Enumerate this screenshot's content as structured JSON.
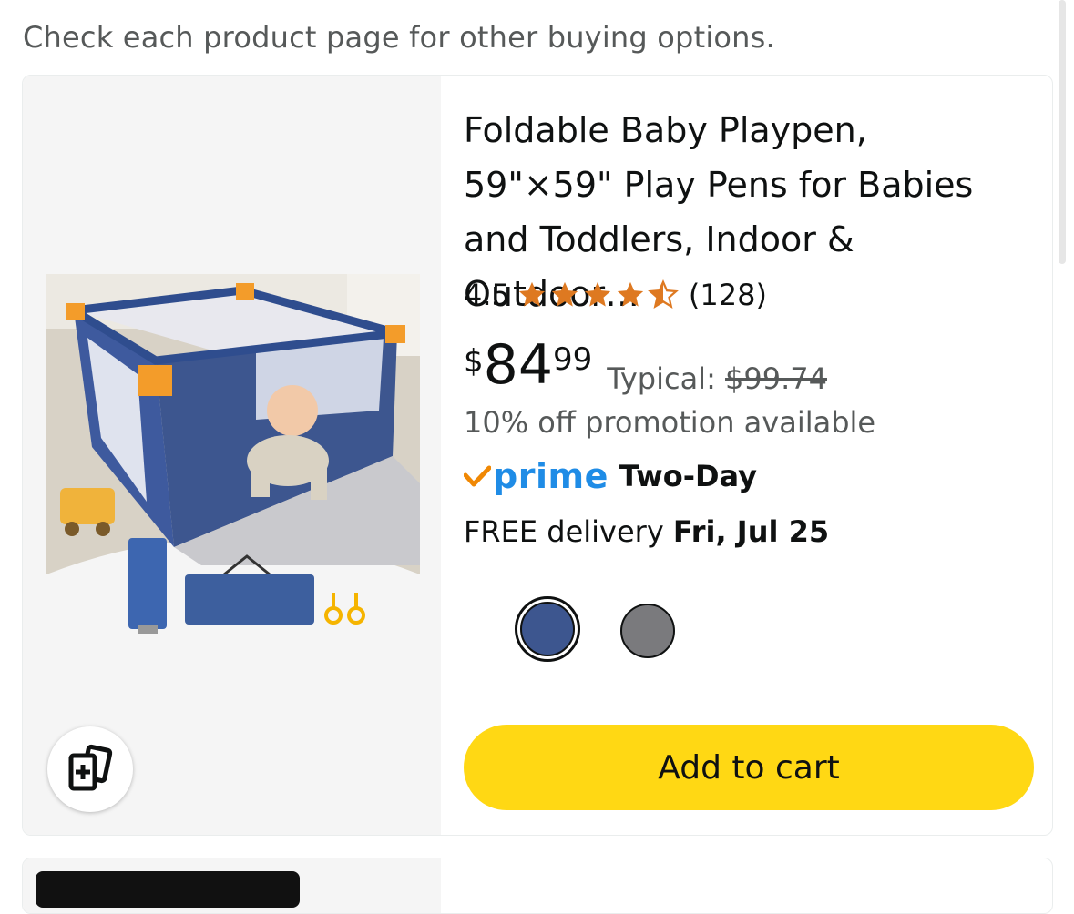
{
  "notice": "Check each product page for other buying options.",
  "product": {
    "title": "Foldable Baby Playpen, 59\"×59\" Play Pens for Babies and Toddlers, Indoor & Outdoor…",
    "rating": "4.5",
    "rating_value": 4.5,
    "rating_count": "(128)",
    "price_currency": "$",
    "price_whole": "84",
    "price_fraction": "99",
    "typical_label": "Typical: ",
    "typical_price": "$99.74",
    "promotion": "10% off promotion available",
    "prime_label": "prime",
    "prime_speed": "Two-Day",
    "delivery_label": "FREE delivery ",
    "delivery_date": "Fri, Jul 25",
    "swatches": [
      {
        "color": "#3d568f",
        "selected": true
      },
      {
        "color": "#7a7a7d",
        "selected": false
      }
    ],
    "add_to_cart": "Add to cart"
  },
  "colors": {
    "accent_button": "#ffd814",
    "star": "#de7921",
    "prime_blue": "#1f8ce6",
    "prime_check": "#f08804"
  },
  "icons": {
    "compare": "compare-cards-icon",
    "star": "star-icon",
    "prime_check": "prime-check-icon"
  }
}
